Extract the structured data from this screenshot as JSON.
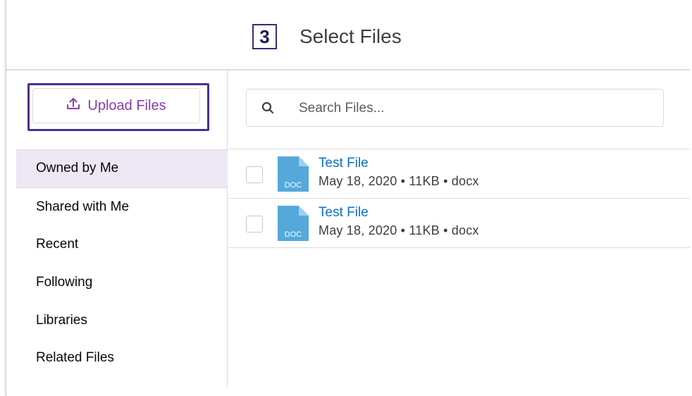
{
  "header": {
    "step_number": "3",
    "title": "Select Files"
  },
  "sidebar": {
    "upload_label": "Upload Files",
    "items": [
      {
        "label": "Owned by Me",
        "active": true
      },
      {
        "label": "Shared with Me",
        "active": false
      },
      {
        "label": "Recent",
        "active": false
      },
      {
        "label": "Following",
        "active": false
      },
      {
        "label": "Libraries",
        "active": false
      },
      {
        "label": "Related Files",
        "active": false
      }
    ]
  },
  "search": {
    "placeholder": "Search Files...",
    "value": ""
  },
  "files": [
    {
      "name": "Test File",
      "meta": "May 18, 2020 • 11KB • docx",
      "icon_label": "DOC",
      "checked": false
    },
    {
      "name": "Test File",
      "meta": "May 18, 2020 • 11KB • docx",
      "icon_label": "DOC",
      "checked": false
    }
  ],
  "colors": {
    "accent_purple": "#8a3bb0",
    "highlight_border": "#4b2f8f",
    "active_nav_bg": "#eee8f5",
    "link_blue": "#0b6fc5",
    "doc_icon": "#54a9da"
  }
}
